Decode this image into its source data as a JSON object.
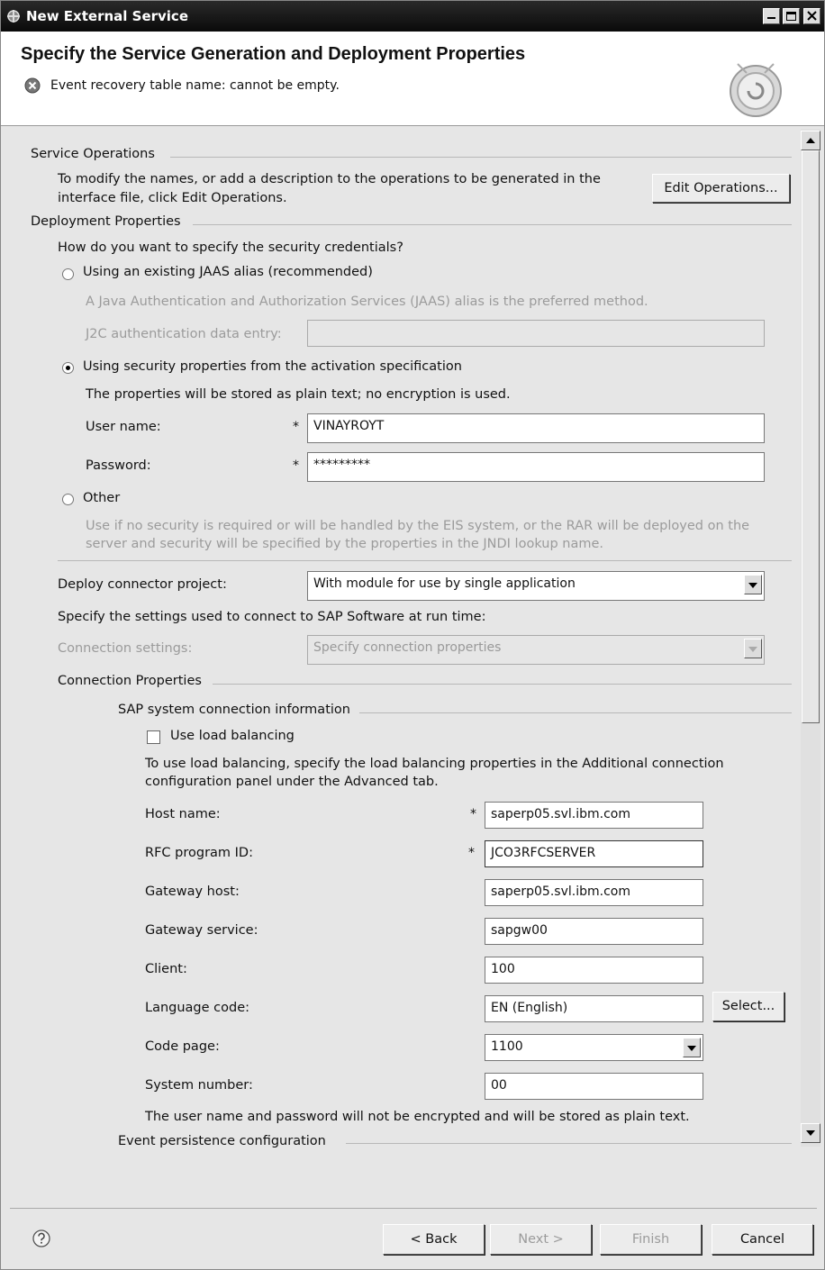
{
  "window": {
    "title": "New External Service"
  },
  "header": {
    "title": "Specify the Service Generation and Deployment Properties",
    "error": "Event recovery table name: cannot be empty."
  },
  "service_ops": {
    "section": "Service Operations",
    "desc_line1": "To modify the names, or add a description to the operations to be generated in the",
    "desc_line2": "interface file, click Edit Operations.",
    "edit_button": "Edit Operations..."
  },
  "deployment": {
    "section": "Deployment Properties",
    "question": "How do you want to specify the security credentials?",
    "jaas_option": "Using an existing JAAS alias (recommended)",
    "jaas_desc": "A Java Authentication and Authorization Services (JAAS) alias is the preferred method.",
    "j2c_label": "J2C authentication data entry:",
    "j2c_value": "",
    "activation_option": "Using security properties from the activation specification",
    "activation_desc": "The properties will be stored as plain text; no encryption is used.",
    "user_label": "User name:",
    "user_value": "VINAYROYT",
    "password_label": "Password:",
    "password_value": "*********",
    "required_mark": "*",
    "other_option": "Other",
    "other_desc_line1": "Use if no security is required or will be handled by the EIS system, or the RAR will be deployed on the",
    "other_desc_line2": "server and security will be specified by the properties in the JNDI lookup name.",
    "deploy_label": "Deploy connector project:",
    "deploy_value": "With module for use by single application",
    "settings_text": "Specify the settings used to connect to SAP Software at run time:",
    "conn_settings_label": "Connection settings:",
    "conn_settings_value": "Specify connection properties"
  },
  "connection": {
    "section": "Connection Properties",
    "subsection": "SAP system connection information",
    "load_balancing": "Use load balancing",
    "lb_desc_line1": "To use load balancing, specify the load balancing properties in the Additional connection",
    "lb_desc_line2": "configuration panel under the Advanced tab.",
    "host_label": "Host name:",
    "host_value": "saperp05.svl.ibm.com",
    "rfc_label": "RFC program ID:",
    "rfc_value": "JCO3RFCSERVER",
    "gw_host_label": "Gateway host:",
    "gw_host_value": "saperp05.svl.ibm.com",
    "gw_service_label": "Gateway service:",
    "gw_service_value": "sapgw00",
    "client_label": "Client:",
    "client_value": "100",
    "lang_label": "Language code:",
    "lang_value": "EN (English)",
    "select_button": "Select...",
    "codepage_label": "Code page:",
    "codepage_value": "1100",
    "sysnum_label": "System number:",
    "sysnum_value": "00",
    "note": "The user name and password will not be encrypted and will be stored as plain text.",
    "next_section": "Event persistence configuration"
  },
  "footer": {
    "back": "< Back",
    "next": "Next >",
    "finish": "Finish",
    "cancel": "Cancel"
  }
}
